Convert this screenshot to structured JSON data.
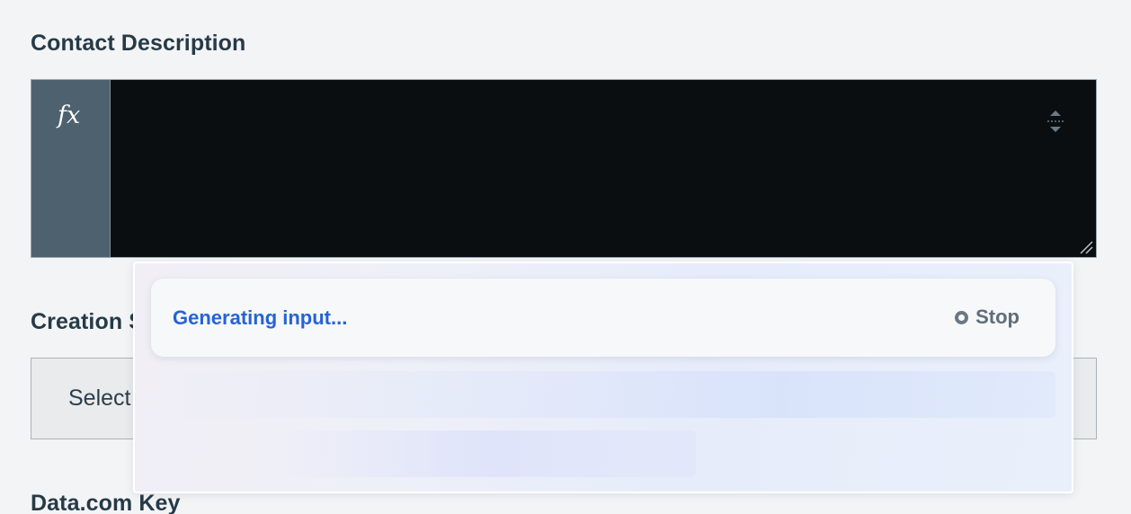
{
  "fields": {
    "contact_description": {
      "label": "Contact Description",
      "fx_label": "fx",
      "value": ""
    },
    "creation_source": {
      "label": "Creation S",
      "select_text": "Select"
    },
    "datacom_key": {
      "label": "Data.com Key"
    }
  },
  "ai_popover": {
    "status_text": "Generating input...",
    "stop_label": "Stop"
  },
  "colors": {
    "status_blue": "#2563d4",
    "editor_bg": "#0a0e10",
    "fx_bg": "#4e616e"
  },
  "icons": {
    "formula": "fx-icon",
    "expand": "expand-icon",
    "resize": "resize-handle-icon",
    "stop": "stop-icon"
  }
}
